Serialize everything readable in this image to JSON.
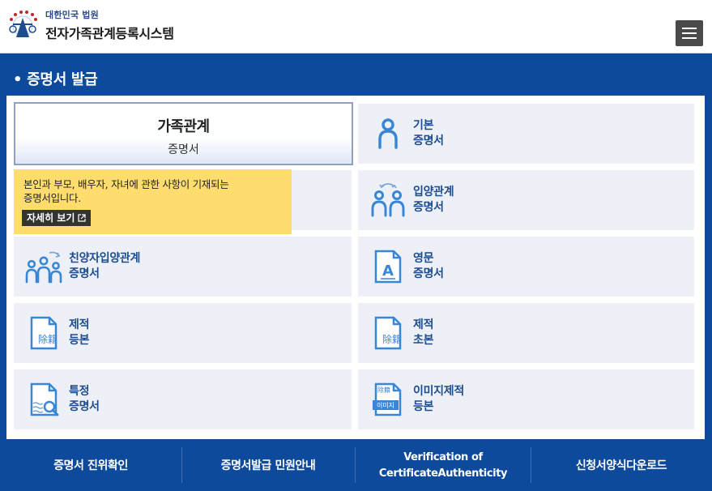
{
  "header": {
    "org_name": "대한민국 법원",
    "system_name": "전자가족관계등록시스템",
    "menu_icon": "hamburger-menu-icon"
  },
  "section": {
    "title": "• 증명서 발급"
  },
  "tiles": {
    "family": {
      "line1": "가족관계",
      "line2": "증명서"
    },
    "basic": {
      "line1": "기본",
      "line2": "증명서",
      "icon": "person-icon"
    },
    "adoption": {
      "line1": "입양관계",
      "line2": "증명서",
      "icon": "adoption-icon"
    },
    "parental": {
      "line1": "친양자입양관계",
      "line2": "증명서",
      "icon": "family-adoption-icon"
    },
    "english": {
      "line1": "영문",
      "line2": "증명서",
      "icon": "english-document-icon"
    },
    "removed_full": {
      "line1": "제적",
      "line2": "등본",
      "icon": "removed-register-icon"
    },
    "removed_abstract": {
      "line1": "제적",
      "line2": "초본",
      "icon": "removed-register-icon"
    },
    "specific": {
      "line1": "특정",
      "line2": "증명서",
      "icon": "document-search-icon"
    },
    "image_removed": {
      "line1": "이미지제적",
      "line2": "등본",
      "icon": "image-document-icon"
    }
  },
  "doc_icon_text": "除籍",
  "image_icon_text": "이미지",
  "tooltip": {
    "line1": "본인과 부모, 배우자, 자녀에 관한 사항이 기재되는",
    "line2": "증명서입니다.",
    "button": "자세히 보기"
  },
  "footer": {
    "item1": "증명서 진위확인",
    "item2": "증명서발급 민원안내",
    "item3_line1": "Verification of",
    "item3_line2": "CertificateAuthenticity",
    "item4": "신청서양식다운로드"
  },
  "colors": {
    "primary_blue": "#0d4a9c",
    "tile_bg": "#edf1f7",
    "tooltip_bg": "#fedc6e",
    "label_blue": "#1d4c8f"
  }
}
